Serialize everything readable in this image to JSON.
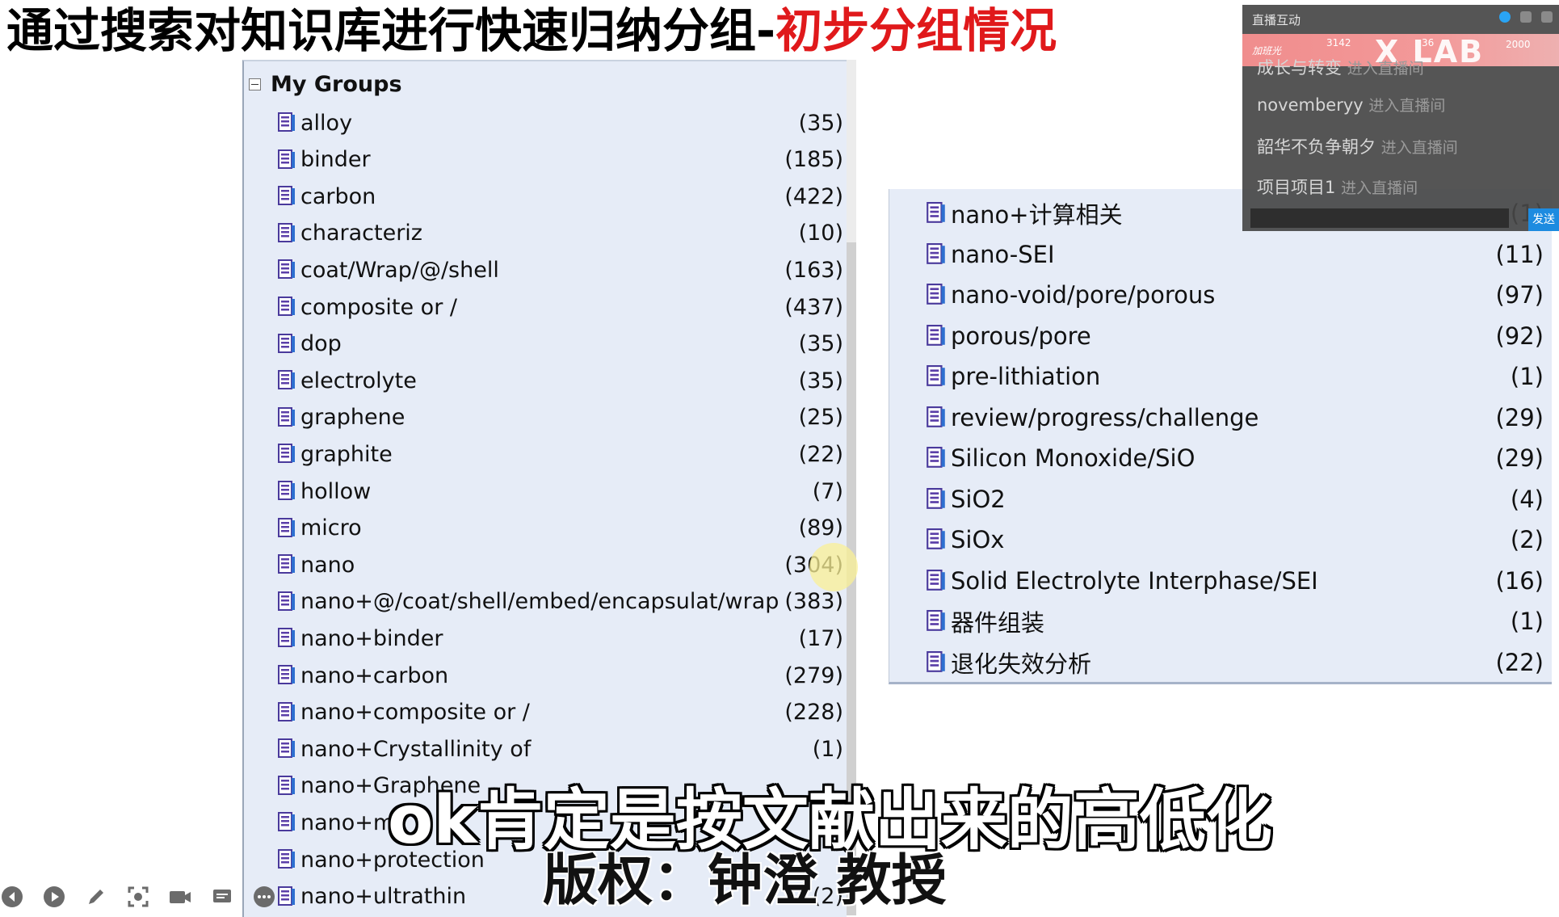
{
  "title": {
    "main": "通过搜索对知识库进行快速归纳分组-",
    "highlight": "初步分组情况"
  },
  "left_tree": {
    "header": "My Groups",
    "items": [
      {
        "label": "alloy",
        "count": "(35)"
      },
      {
        "label": "binder",
        "count": "(185)"
      },
      {
        "label": "carbon",
        "count": "(422)"
      },
      {
        "label": "characteriz",
        "count": "(10)"
      },
      {
        "label": "coat/Wrap/@/shell",
        "count": "(163)"
      },
      {
        "label": "composite or /",
        "count": "(437)"
      },
      {
        "label": "dop",
        "count": "(35)"
      },
      {
        "label": "electrolyte",
        "count": "(35)"
      },
      {
        "label": "graphene",
        "count": "(25)"
      },
      {
        "label": "graphite",
        "count": "(22)"
      },
      {
        "label": "hollow",
        "count": "(7)"
      },
      {
        "label": "micro",
        "count": "(89)"
      },
      {
        "label": "nano",
        "count": "(304)"
      },
      {
        "label": "nano+@/coat/shell/embed/encapsulat/wrap",
        "count": "(383)"
      },
      {
        "label": "nano+binder",
        "count": "(17)"
      },
      {
        "label": "nano+carbon",
        "count": "(279)"
      },
      {
        "label": "nano+composite or /",
        "count": "(228)"
      },
      {
        "label": "nano+Crystallinity of",
        "count": "(1)"
      },
      {
        "label": "nano+Graphene",
        "count": ""
      },
      {
        "label": "nano+mi",
        "count": ""
      },
      {
        "label": "nano+protection",
        "count": ""
      },
      {
        "label": "nano+ultrathin",
        "count": "(2)"
      }
    ]
  },
  "right_tree": {
    "items": [
      {
        "label": "nano+计算相关",
        "count": "(1)"
      },
      {
        "label": "nano-SEI",
        "count": "(11)"
      },
      {
        "label": "nano-void/pore/porous",
        "count": "(97)"
      },
      {
        "label": "porous/pore",
        "count": "(92)"
      },
      {
        "label": "pre-lithiation",
        "count": "(1)"
      },
      {
        "label": "review/progress/challenge",
        "count": "(29)"
      },
      {
        "label": "Silicon Monoxide/SiO",
        "count": "(29)"
      },
      {
        "label": "SiO2",
        "count": "(4)"
      },
      {
        "label": "SiOx",
        "count": "(2)"
      },
      {
        "label": "Solid Electrolyte Interphase/SEI",
        "count": "(16)"
      },
      {
        "label": "器件组装",
        "count": "(1)"
      },
      {
        "label": "退化失效分析",
        "count": "(22)"
      }
    ]
  },
  "live": {
    "title": "直播互动",
    "banner_left": "加班光",
    "banner_num": "3142",
    "banner_num2": "36",
    "banner_logo": "X LAB",
    "banner_right": "2000",
    "messages": [
      {
        "user": "成长与转变",
        "text": "进入直播间"
      },
      {
        "user": "novemberyy",
        "text": "进入直播间"
      },
      {
        "user": "韶华不负争朝夕",
        "text": "进入直播间"
      },
      {
        "user": "项目项目1",
        "text": "进入直播间"
      }
    ],
    "send_label": "发送"
  },
  "subtitles": {
    "line1": "ok肯定是按文献出来的高低化",
    "line2": "版权：钟澄 教授"
  },
  "icons": {
    "group_icon": "group-folder-icon",
    "toolbar": [
      "back-icon",
      "play-icon",
      "pen-icon",
      "screenshot-icon",
      "camera-icon",
      "caption-icon",
      "more-icon"
    ]
  },
  "colors": {
    "title_red": "#e0191b",
    "panel_bg": "#e6ecf7",
    "icon_purple": "#5b3fa8"
  }
}
